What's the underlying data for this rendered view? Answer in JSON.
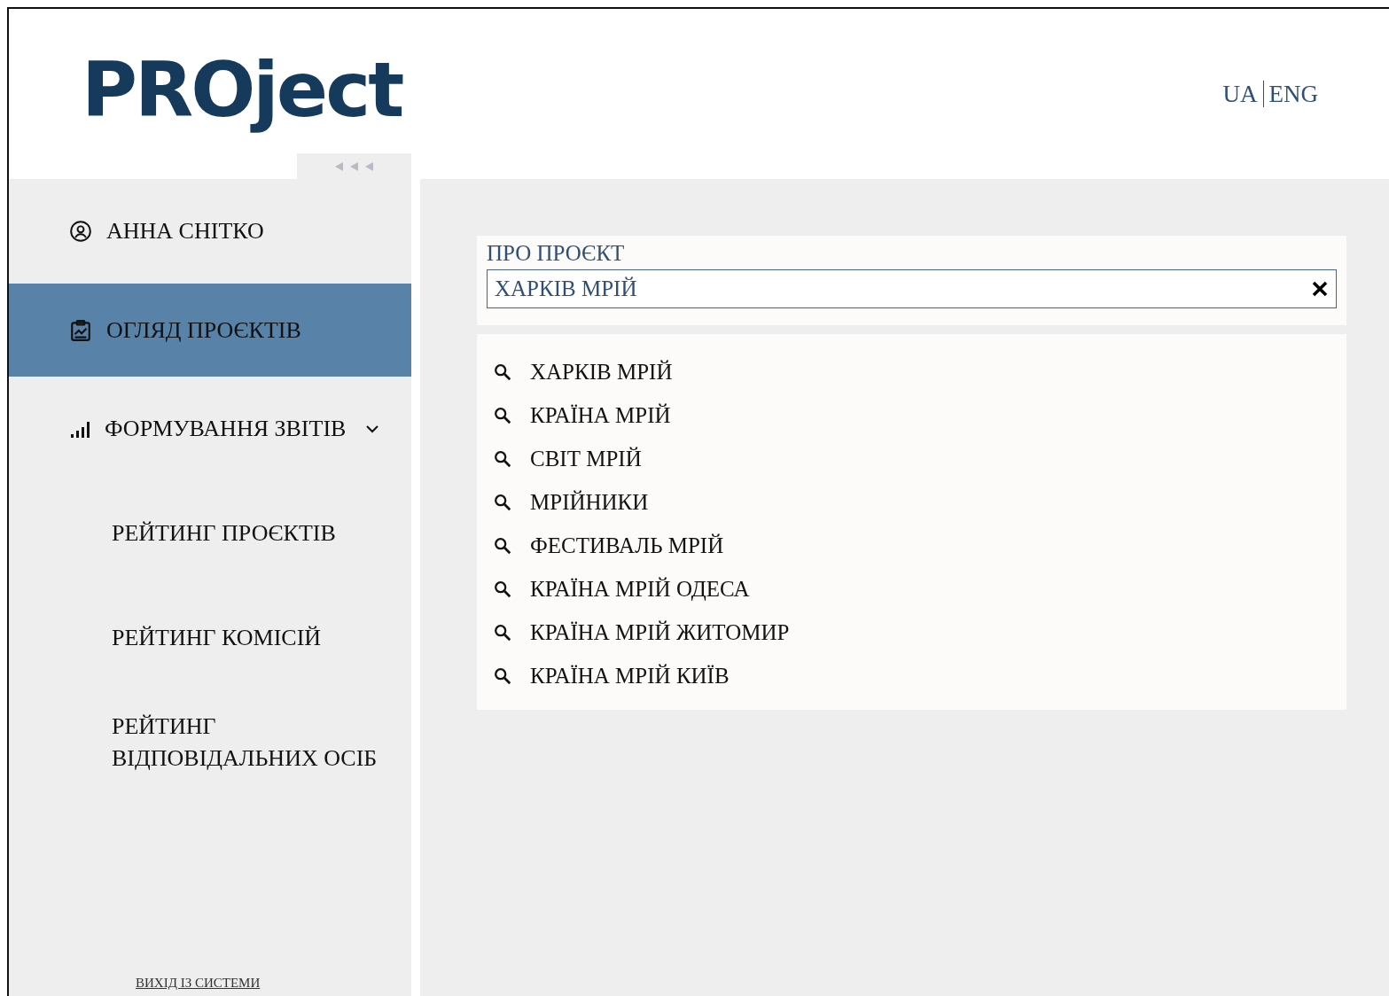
{
  "logo": "PROject",
  "languages": [
    {
      "label": "UA",
      "selected": false
    },
    {
      "label": "ENG",
      "selected": false
    }
  ],
  "sidebar": {
    "items": [
      {
        "kind": "user",
        "label": "АННА СНІТКО",
        "selected": false
      },
      {
        "kind": "overview",
        "label": "ОГЛЯД ПРОЄКТІВ",
        "selected": true
      },
      {
        "kind": "reports",
        "label": "ФОРМУВАННЯ ЗВІТІВ",
        "selected": false,
        "expanded": true,
        "children": [
          {
            "label": "РЕЙТИНГ ПРОЄКТІВ"
          },
          {
            "label": "РЕЙТИНГ КОМІСІЙ"
          },
          {
            "label": "РЕЙТИНГ ВІДПОВІДАЛЬНИХ ОСІБ"
          }
        ]
      }
    ],
    "logout": "ВИХІД ІЗ СИСТЕМИ"
  },
  "search": {
    "label": "ПРО ПРОЄКТ",
    "value": "ХАРКІВ МРІЙ"
  },
  "suggestions": [
    "ХАРКІВ МРІЙ",
    "КРАЇНА МРІЙ",
    "СВІТ МРІЙ",
    "МРІЙНИКИ",
    "ФЕСТИВАЛЬ МРІЙ",
    "КРАЇНА МРІЙ ОДЕСА",
    "КРАЇНА МРІЙ ЖИТОМИР",
    "КРАЇНА МРІЙ КИЇВ"
  ]
}
